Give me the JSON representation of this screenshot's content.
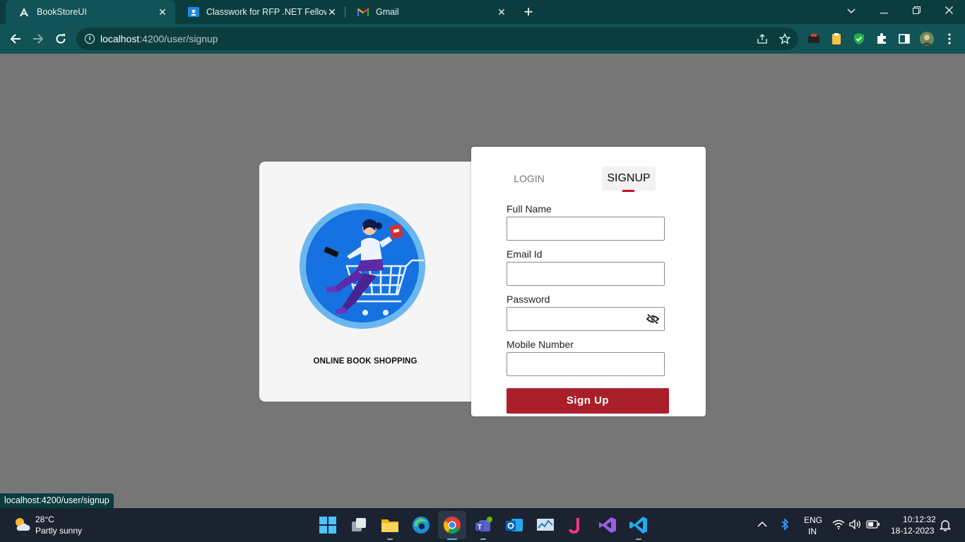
{
  "browser": {
    "tabs": [
      {
        "title": "BookStoreUI",
        "icon": "angular-icon"
      },
      {
        "title": "Classwork for RFP .NET Fellowsh",
        "icon": "classroom-icon"
      },
      {
        "title": "Gmail",
        "icon": "gmail-icon"
      }
    ],
    "close_glyph": "✕",
    "new_tab_glyph": "+",
    "address": {
      "host": "localhost",
      "path": ":4200/user/signup"
    }
  },
  "brand": {
    "name": "ONLINE BOOK SHOPPING"
  },
  "auth_tabs": {
    "login": "LOGIN",
    "signup": "SIGNUP"
  },
  "form": {
    "full_name_label": "Full Name",
    "email_label": "Email Id",
    "password_label": "Password",
    "mobile_label": "Mobile Number",
    "full_name_value": "",
    "email_value": "",
    "password_value": "",
    "mobile_value": "",
    "submit_label": "Sign Up"
  },
  "status_bar": {
    "url": "localhost:4200/user/signup"
  },
  "taskbar": {
    "weather_temp": "28°C",
    "weather_desc": "Partly sunny",
    "lang_top": "ENG",
    "lang_bottom": "IN",
    "time": "10:12:32",
    "date": "18-12-2023"
  },
  "colors": {
    "accent": "#a9202b",
    "tab_indicator": "#c8102e",
    "chrome_dark": "#0b3d3f",
    "chrome": "#115356",
    "backdrop": "#767676"
  }
}
